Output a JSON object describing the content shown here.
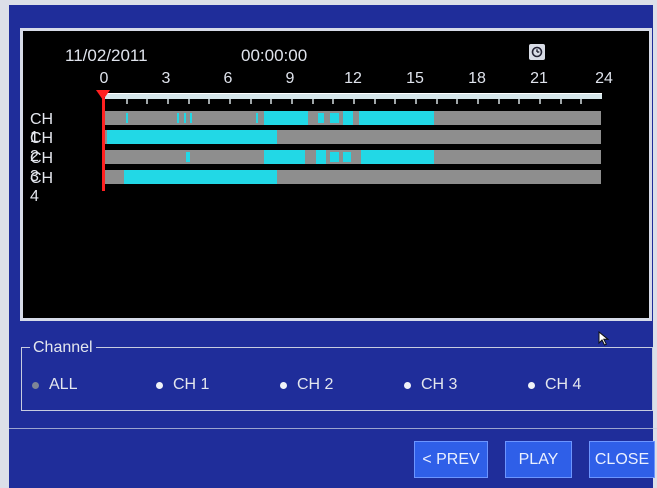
{
  "header": {
    "date": "11/02/2011",
    "time": "00:00:00",
    "icon": "clock-icon"
  },
  "timeline": {
    "hour_labels": [
      "0",
      "3",
      "6",
      "9",
      "12",
      "15",
      "18",
      "21",
      "24"
    ],
    "range_hours": [
      0,
      24
    ],
    "cursor_hour": 0,
    "channels": [
      {
        "label": "CH 1",
        "segments": [
          [
            1.0,
            1.1
          ],
          [
            3.5,
            3.6
          ],
          [
            3.8,
            3.9
          ],
          [
            4.1,
            4.2
          ],
          [
            7.3,
            7.4
          ],
          [
            7.7,
            9.8
          ],
          [
            10.3,
            10.6
          ],
          [
            10.9,
            11.3
          ],
          [
            11.5,
            12.0
          ],
          [
            12.3,
            15.9
          ]
        ]
      },
      {
        "label": "CH 2",
        "segments": [
          [
            0.1,
            8.3
          ]
        ]
      },
      {
        "label": "CH 3",
        "segments": [
          [
            3.9,
            4.1
          ],
          [
            7.7,
            9.7
          ],
          [
            10.2,
            10.7
          ],
          [
            10.9,
            11.3
          ],
          [
            11.5,
            11.9
          ],
          [
            12.4,
            15.9
          ]
        ]
      },
      {
        "label": "CH 4",
        "segments": [
          [
            0.9,
            8.3
          ]
        ]
      }
    ],
    "colors": {
      "track": "#8e8e8e",
      "recording": "#22d8e6",
      "cursor": "#ff2020"
    }
  },
  "channel_select": {
    "title": "Channel",
    "options": [
      {
        "label": "ALL",
        "selected": true
      },
      {
        "label": "CH 1",
        "selected": false
      },
      {
        "label": "CH 2",
        "selected": false
      },
      {
        "label": "CH 3",
        "selected": false
      },
      {
        "label": "CH 4",
        "selected": false
      }
    ]
  },
  "buttons": {
    "prev": "< PREV",
    "play": "PLAY",
    "close": "CLOSE"
  }
}
